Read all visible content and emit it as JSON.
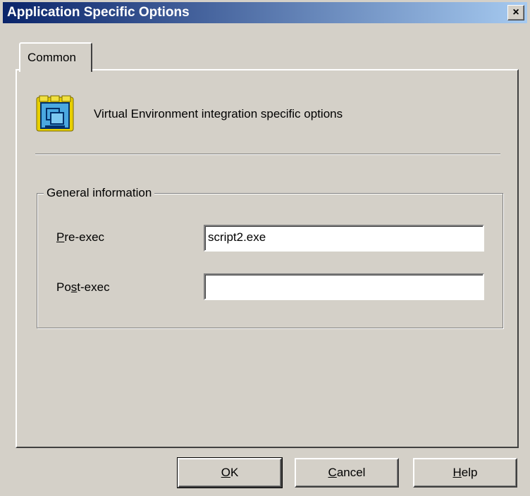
{
  "window": {
    "title": "Application Specific Options",
    "close_glyph": "×"
  },
  "tabs": [
    {
      "label": "Common"
    }
  ],
  "header": {
    "icon": "app-window-icon",
    "description": "Virtual Environment integration specific options"
  },
  "group": {
    "title": "General information",
    "fields": [
      {
        "label_mnemonic": "P",
        "label_rest": "re-exec",
        "value": "script2.exe"
      },
      {
        "label_pre": "Po",
        "label_mnemonic": "s",
        "label_rest": "t-exec",
        "value": ""
      }
    ]
  },
  "buttons": {
    "ok": {
      "mnemonic": "O",
      "rest": "K"
    },
    "cancel": {
      "mnemonic": "C",
      "rest": "ancel"
    },
    "help": {
      "mnemonic": "H",
      "rest": "elp"
    }
  },
  "colors": {
    "face": "#d4d0c8",
    "title_start": "#0a246a",
    "title_end": "#a6caf0"
  }
}
